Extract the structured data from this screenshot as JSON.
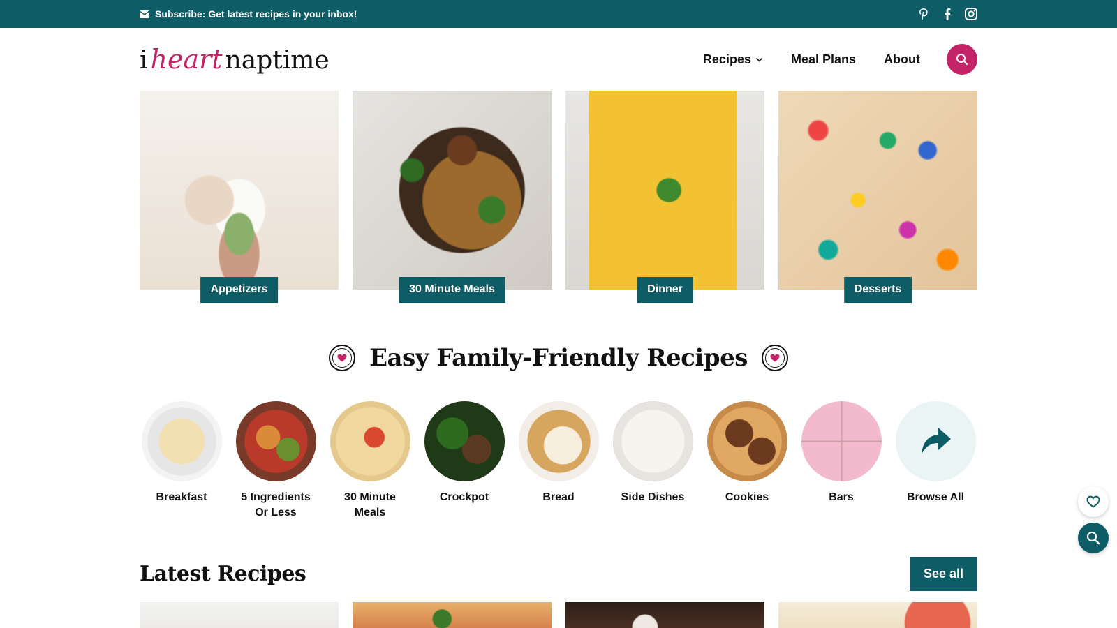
{
  "colors": {
    "teal": "#0d5c66",
    "pink": "#c32468",
    "text": "#111111",
    "browse_bg": "#ebf4f5"
  },
  "topbar": {
    "subscribe_icon": "envelope-icon",
    "subscribe_text": "Subscribe: Get latest recipes in your inbox!",
    "social_icons": [
      "pinterest-icon",
      "facebook-icon",
      "instagram-icon"
    ]
  },
  "logo": {
    "part1": "i",
    "part2": "heart",
    "part3": "naptime"
  },
  "nav": {
    "items": [
      {
        "label": "Recipes",
        "has_dropdown": true
      },
      {
        "label": "Meal Plans"
      },
      {
        "label": "About"
      }
    ],
    "search_icon": "search-icon"
  },
  "category_cards": [
    {
      "label": "Appetizers"
    },
    {
      "label": "30 Minute Meals"
    },
    {
      "label": "Dinner"
    },
    {
      "label": "Desserts"
    }
  ],
  "section": {
    "title": "Easy Family-Friendly Recipes",
    "badge_icon": "heart-icon"
  },
  "circle_categories": [
    {
      "label": "Breakfast"
    },
    {
      "label": "5 Ingredients Or Less"
    },
    {
      "label": "30 Minute Meals"
    },
    {
      "label": "Crockpot"
    },
    {
      "label": "Bread"
    },
    {
      "label": "Side Dishes"
    },
    {
      "label": "Cookies"
    },
    {
      "label": "Bars"
    },
    {
      "label": "Browse All",
      "icon": "share-arrow-icon"
    }
  ],
  "latest": {
    "title": "Latest Recipes",
    "see_all": "See all"
  },
  "floating": {
    "favorites_icon": "heart-outline-icon",
    "search_icon": "search-icon"
  }
}
